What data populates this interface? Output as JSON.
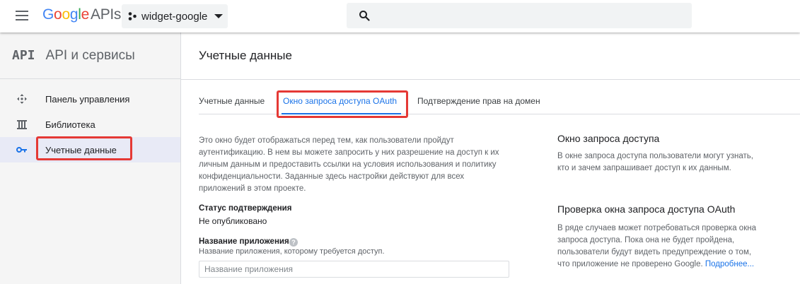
{
  "header": {
    "logo": {
      "g1": "G",
      "g2": "o",
      "g3": "o",
      "g4": "g",
      "g5": "l",
      "g6": "e",
      "apis": "APIs"
    },
    "project_name": "widget-google",
    "search_placeholder": ""
  },
  "sidebar": {
    "icon_text": "API",
    "title": "API и сервисы",
    "items": [
      {
        "label": "Панель управления",
        "icon": "dashboard-icon",
        "active": false
      },
      {
        "label": "Библиотека",
        "icon": "library-icon",
        "active": false
      },
      {
        "label": "Учетные данные",
        "icon": "key-icon",
        "active": true
      }
    ]
  },
  "main": {
    "title": "Учетные данные",
    "tabs": [
      {
        "label": "Учетные данные",
        "active": false
      },
      {
        "label": "Окно запроса доступа OAuth",
        "active": true
      },
      {
        "label": "Подтверждение прав на домен",
        "active": false
      }
    ],
    "description": "Это окно будет отображаться перед тем, как пользователи пройдут аутентификацию. В нем вы можете запросить у них разрешение на доступ к их личным данным и предоставить ссылки на условия использования и политику конфиденциальности. Заданные здесь настройки действуют для всех приложений в этом проекте.",
    "status": {
      "label": "Статус подтверждения",
      "value": "Не опубликовано"
    },
    "app_name": {
      "label": "Название приложения",
      "help": "?",
      "hint": "Название приложения, которому требуется доступ.",
      "placeholder": "Название приложения",
      "value": ""
    },
    "side": {
      "heading1": "Окно запроса доступа",
      "text1": "В окне запроса доступа пользователи могут узнать, кто и зачем запрашивает доступ к их данным.",
      "heading2": "Проверка окна запроса доступа OAuth",
      "text2": "В ряде случаев может потребоваться проверка окна запроса доступа. Пока она не будет пройдена, пользователи будут видеть предупреждение о том, что приложение не проверено Google.",
      "link": "Подробнее..."
    }
  },
  "colors": {
    "accent": "#1a73e8",
    "highlight_box": "#e53935",
    "sidebar_bg": "#f5f5f5",
    "active_item_bg": "#e8eaf6"
  }
}
